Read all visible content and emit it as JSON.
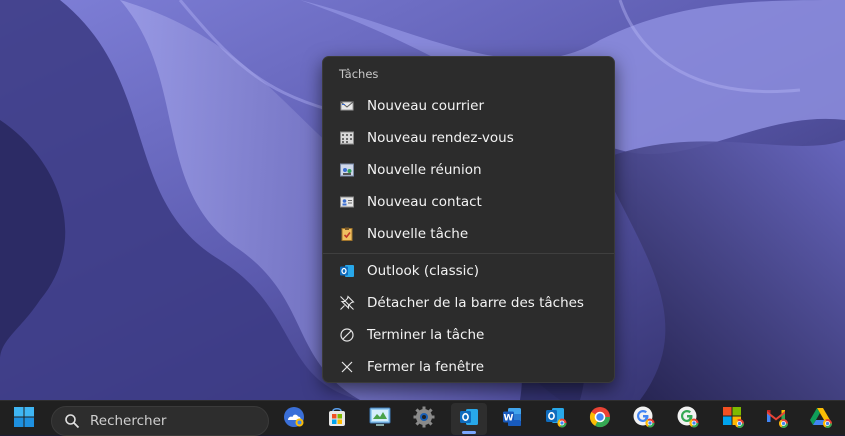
{
  "menu": {
    "section_title": "Tâches",
    "tasks": [
      {
        "label": "Nouveau courrier",
        "icon": "new-mail-icon"
      },
      {
        "label": "Nouveau rendez-vous",
        "icon": "calendar-icon"
      },
      {
        "label": "Nouvelle réunion",
        "icon": "meeting-icon"
      },
      {
        "label": "Nouveau contact",
        "icon": "contact-card-icon"
      },
      {
        "label": "Nouvelle tâche",
        "icon": "task-clipboard-icon"
      }
    ],
    "items": [
      {
        "label": "Outlook (classic)",
        "icon": "outlook-icon"
      },
      {
        "label": "Détacher de la barre des tâches",
        "icon": "unpin-icon"
      },
      {
        "label": "Terminer la tâche",
        "icon": "end-task-icon"
      },
      {
        "label": "Fermer la fenêtre",
        "icon": "close-icon"
      }
    ]
  },
  "taskbar": {
    "search_placeholder": "Rechercher",
    "apps": [
      {
        "name": "start-button",
        "icon": "windows-logo-icon"
      },
      {
        "name": "onedrive-button",
        "icon": "onedrive-icon"
      },
      {
        "name": "store-button",
        "icon": "store-icon"
      },
      {
        "name": "control-panel-button",
        "icon": "control-panel-icon"
      },
      {
        "name": "settings-button",
        "icon": "gear-icon"
      },
      {
        "name": "outlook-button",
        "icon": "outlook-icon",
        "active": true
      },
      {
        "name": "word-button",
        "icon": "word-icon"
      },
      {
        "name": "outlook-chrome-button",
        "icon": "outlook-chrome-icon"
      },
      {
        "name": "chrome-button",
        "icon": "chrome-icon"
      },
      {
        "name": "google-chrome-app-button",
        "icon": "google-chrome-icon"
      },
      {
        "name": "google-chrome-app-2-button",
        "icon": "google-chrome-icon"
      },
      {
        "name": "microsoft-chrome-button",
        "icon": "microsoft-chrome-icon"
      },
      {
        "name": "gmail-button",
        "icon": "gmail-icon"
      },
      {
        "name": "drive-button",
        "icon": "google-drive-icon"
      }
    ]
  },
  "colors": {
    "menu_bg": "#2c2c2c",
    "taskbar_bg": "#202020",
    "accent": "#7aa7ff",
    "wallpaper_base": "#5d5cb0"
  }
}
